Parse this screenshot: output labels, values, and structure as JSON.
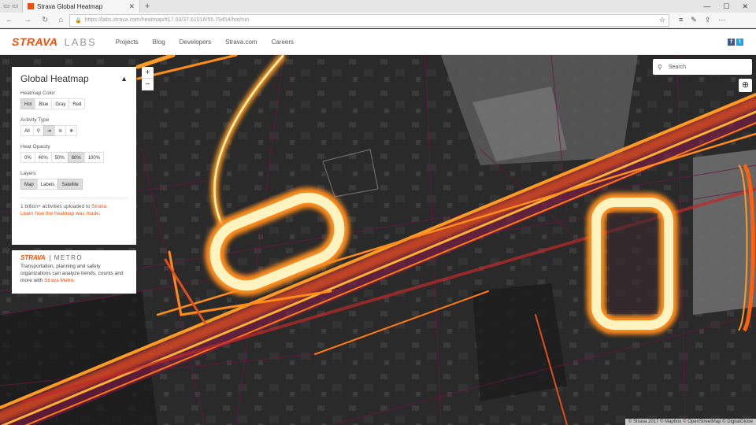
{
  "browser": {
    "tab_title": "Strava Global Heatmap",
    "url": "https://labs.strava.com/heatmap/#17.00/37.61016/55.79454/hot/run",
    "new_tab": "+",
    "tab_close": "✕"
  },
  "site": {
    "logo": "STRAVA",
    "labs": "LABS",
    "nav": [
      "Projects",
      "Blog",
      "Developers",
      "Strava.com",
      "Careers"
    ]
  },
  "panel": {
    "title": "Global Heatmap",
    "heatmap_color_label": "Heatmap Color",
    "heatmap_colors": [
      "Hot",
      "Blue",
      "Gray",
      "Red"
    ],
    "heatmap_color_selected": "Hot",
    "activity_type_label": "Activity Type",
    "activity_types": [
      "All",
      "ride-icon",
      "run-icon",
      "water-icon",
      "winter-icon"
    ],
    "activity_type_selected": "run-icon",
    "opacity_label": "Heat Opacity",
    "opacities": [
      "0%",
      "40%",
      "50%",
      "60%",
      "100%"
    ],
    "opacity_selected": "60%",
    "layers_label": "Layers",
    "layers": [
      "Map",
      "Labels",
      "Satellite"
    ],
    "layer_selected": "Satellite",
    "info_line1_pre": "1 billion+ activities uploaded to ",
    "info_line1_link": "Strava",
    "info_line1_post": ".",
    "info_line2_link": "Learn how the heatmap was made",
    "info_line2_post": "."
  },
  "metro": {
    "logo_strava": "STRAVA",
    "logo_metro": "METRO",
    "text": "Transportation, planning and safety organizations can analyze trends, counts and more with ",
    "link": "Strava Metro",
    "end": "."
  },
  "map": {
    "zoom_in": "+",
    "zoom_out": "−",
    "search_placeholder": "Search",
    "attribution": "© Strava 2017 © Mapbox © OpenStreetMap © DigitalGlobe"
  },
  "colors": {
    "brand": "#fc4c02",
    "heat_core": "#fff3c0",
    "heat_mid": "#ff8c1a",
    "heat_low": "#8b1a4a"
  }
}
